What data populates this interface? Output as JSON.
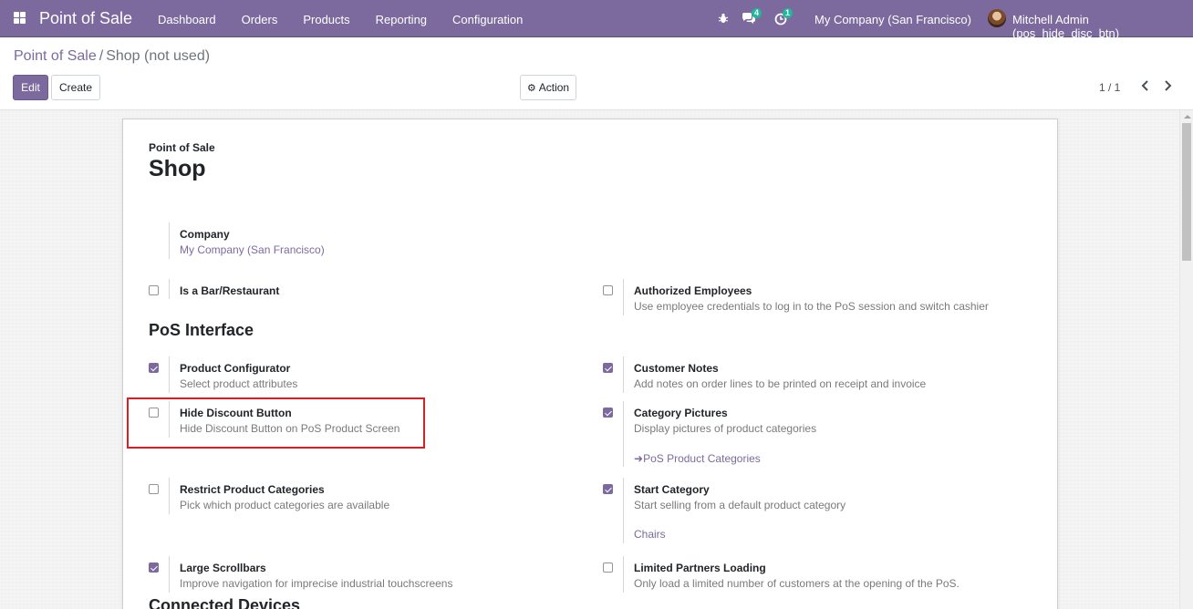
{
  "navbar": {
    "brand": "Point of Sale",
    "menu": [
      "Dashboard",
      "Orders",
      "Products",
      "Reporting",
      "Configuration"
    ],
    "messages_count": "4",
    "activities_count": "1",
    "company": "My Company (San Francisco)",
    "user": "Mitchell Admin (pos_hide_disc_btn)"
  },
  "breadcrumb": {
    "parent": "Point of Sale",
    "separator": "/",
    "current": "Shop (not used)"
  },
  "toolbar": {
    "edit_label": "Edit",
    "create_label": "Create",
    "action_label": "Action"
  },
  "pager": {
    "value": "1 / 1"
  },
  "form": {
    "subtitle": "Point of Sale",
    "title": "Shop",
    "company_label": "Company",
    "company_value": "My Company (San Francisco)",
    "section_pos_interface": "PoS Interface",
    "section_connected_devices": "Connected Devices",
    "settings": {
      "bar_restaurant": {
        "label": "Is a Bar/Restaurant",
        "checked": false
      },
      "authorized_employees": {
        "label": "Authorized Employees",
        "help": "Use employee credentials to log in to the PoS session and switch cashier",
        "checked": false
      },
      "product_configurator": {
        "label": "Product Configurator",
        "help": "Select product attributes",
        "checked": true
      },
      "customer_notes": {
        "label": "Customer Notes",
        "help": "Add notes on order lines to be printed on receipt and invoice",
        "checked": true
      },
      "hide_discount": {
        "label": "Hide Discount Button",
        "help": "Hide Discount Button on PoS Product Screen",
        "checked": false
      },
      "category_pictures": {
        "label": "Category Pictures",
        "help": "Display pictures of product categories",
        "link": "PoS Product Categories",
        "checked": true
      },
      "restrict_categories": {
        "label": "Restrict Product Categories",
        "help": "Pick which product categories are available",
        "checked": false
      },
      "start_category": {
        "label": "Start Category",
        "help": "Start selling from a default product category",
        "value": "Chairs",
        "checked": true
      },
      "large_scrollbars": {
        "label": "Large Scrollbars",
        "help": "Improve navigation for imprecise industrial touchscreens",
        "checked": true
      },
      "limited_partners": {
        "label": "Limited Partners Loading",
        "help": "Only load a limited number of customers at the opening of the PoS.",
        "checked": false
      }
    }
  },
  "colors": {
    "brand": "#7c6a9e",
    "badge": "#21b799",
    "highlight": "#dc1d1d"
  }
}
